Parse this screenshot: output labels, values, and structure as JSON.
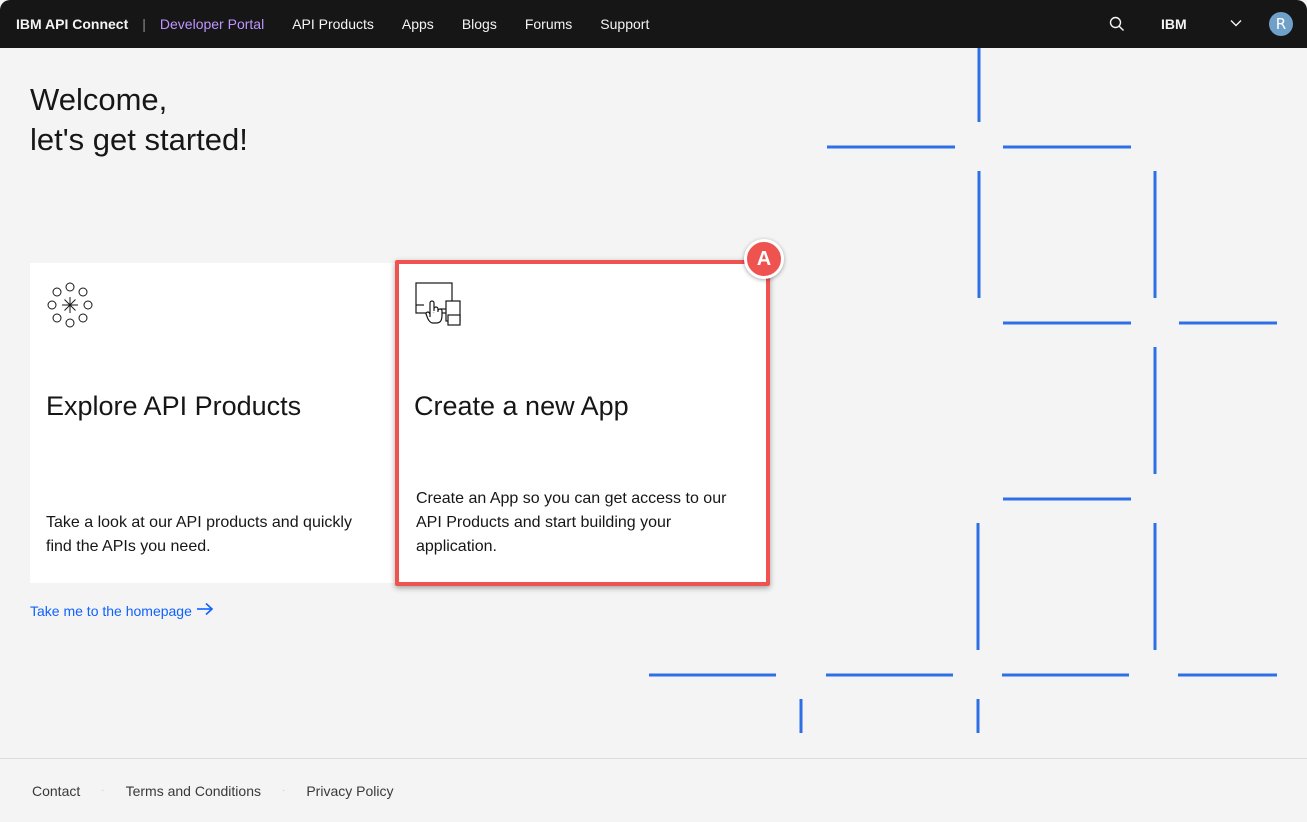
{
  "header": {
    "brand": "IBM API Connect",
    "separator": "|",
    "portal": "Developer Portal",
    "nav": [
      "API Products",
      "Apps",
      "Blogs",
      "Forums",
      "Support"
    ],
    "org": "IBM",
    "avatar_initial": "R",
    "icons": {
      "search": "search-icon",
      "org_dropdown": "chevron-down-icon"
    }
  },
  "welcome": {
    "line1": "Welcome,",
    "line2": "let's get started!"
  },
  "cards": {
    "explore": {
      "icon": "api-products-icon",
      "title": "Explore API Products",
      "description": "Take a look at our API products and quickly find the APIs you need."
    },
    "create": {
      "icon": "create-app-icon",
      "title": "Create a new App",
      "description": "Create an App so you can get access to our API Products and start building your application."
    }
  },
  "annotation": {
    "label": "A",
    "color": "#ef5350"
  },
  "home_link": {
    "label": "Take me to the homepage",
    "icon": "arrow-right-icon"
  },
  "footer": {
    "links": [
      "Contact",
      "Terms and Conditions",
      "Privacy Policy"
    ]
  },
  "colors": {
    "topbar": "#161616",
    "portal_accent": "#be95ff",
    "link_blue": "#0f62fe",
    "decor_blue": "#2f6fe6",
    "background": "#f4f4f4"
  }
}
